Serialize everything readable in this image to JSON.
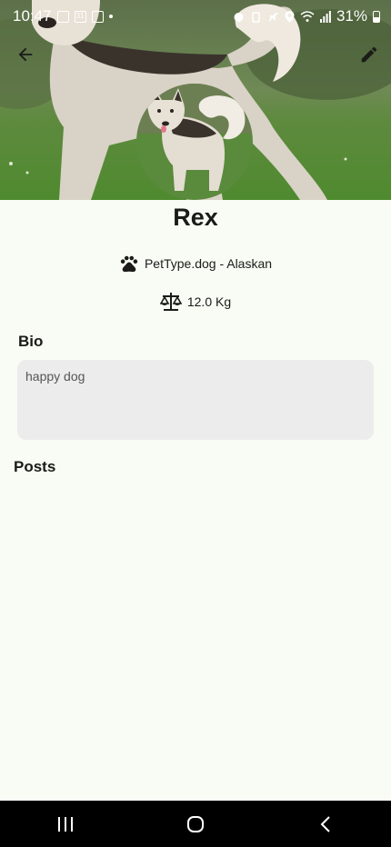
{
  "status_bar": {
    "time": "10:47",
    "battery": "31%",
    "left_icons": [
      "gallery-icon",
      "calendar-icon",
      "card-icon",
      "dot-icon"
    ],
    "right_icons": [
      "alarm-icon",
      "vibrate-icon",
      "mute-icon",
      "location-icon",
      "wifi-icon",
      "signal-icon",
      "battery-icon"
    ]
  },
  "app_bar": {
    "back_icon": "arrow-back-icon",
    "edit_icon": "pencil-icon"
  },
  "pet": {
    "name": "Rex",
    "type_breed": "PetType.dog - Alaskan",
    "weight": "12.0 Kg",
    "type_icon": "paw-icon",
    "weight_icon": "scale-icon"
  },
  "bio": {
    "title": "Bio",
    "text": "happy dog"
  },
  "posts": {
    "title": "Posts"
  },
  "nav": {
    "recents_icon": "recents-icon",
    "home_icon": "home-icon",
    "back_icon": "nav-back-icon"
  },
  "colors": {
    "background": "#f9fbf5",
    "bio_box": "#ececec",
    "text": "#1b1c18",
    "nav_bar": "#000000"
  }
}
